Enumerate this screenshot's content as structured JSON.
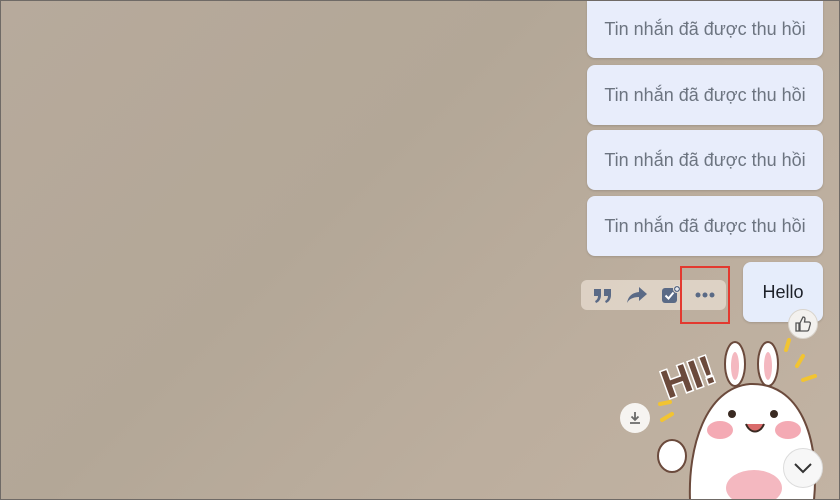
{
  "messages": {
    "recalled": [
      {
        "text": "Tin nhắn đã được thu hồi"
      },
      {
        "text": "Tin nhắn đã được thu hồi"
      },
      {
        "text": "Tin nhắn đã được thu hồi"
      },
      {
        "text": "Tin nhắn đã được thu hồi"
      }
    ],
    "hello": {
      "text": "Hello"
    }
  },
  "toolbar": {
    "icons": [
      "quote-icon",
      "forward-icon",
      "pin-task-icon",
      "more-icon"
    ]
  },
  "sticker": {
    "text": "HI!"
  },
  "colors": {
    "bubble": "#e8edfb",
    "highlight": "#e3392f",
    "toolbar_icon": "#5a6a86"
  }
}
